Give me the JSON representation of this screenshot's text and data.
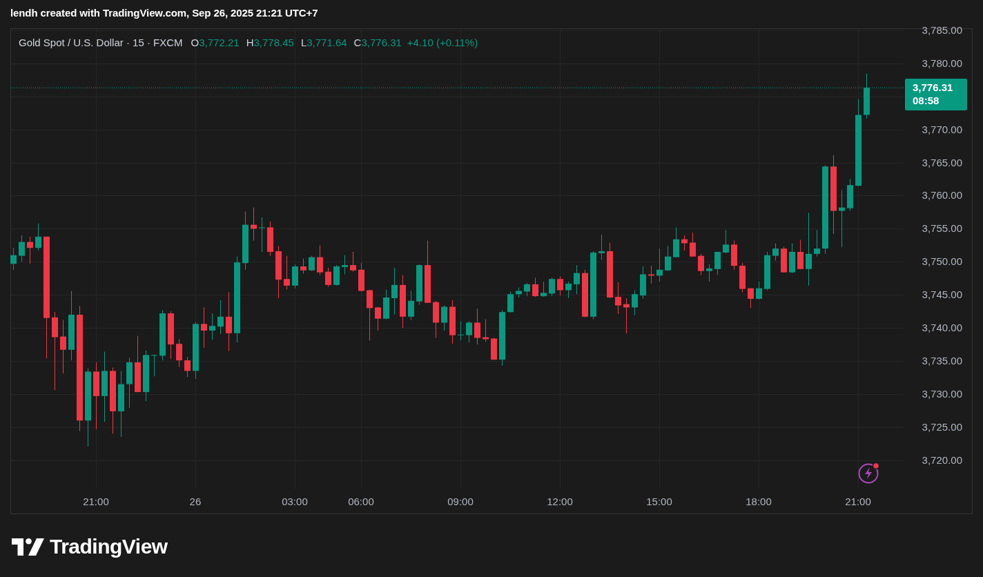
{
  "header": {
    "title": "lendh created with TradingView.com, Sep 26, 2025 21:21 UTC+7"
  },
  "chart": {
    "legend": {
      "symbol": "Gold Spot / U.S. Dollar · 15 · FXCM",
      "fields": [
        {
          "label": "O",
          "value": "3,772.21"
        },
        {
          "label": "H",
          "value": "3,778.45"
        },
        {
          "label": "L",
          "value": "3,771.64"
        },
        {
          "label": "C",
          "value": "3,776.31"
        }
      ],
      "change": "+4.10 (+0.11%)"
    },
    "price_label": {
      "price": "3,776.31",
      "countdown": "08:58"
    },
    "candle_colors": [
      {
        "kind": "rising",
        "color": "#089981"
      },
      {
        "kind": "falling",
        "color": "#f23645"
      }
    ],
    "chart_data": {
      "type": "candlestick",
      "ylim": [
        3715.7,
        3785.3
      ],
      "grid": true,
      "ref_lines": [
        {
          "axis": "y",
          "value": 3776.31,
          "color": "#089981"
        }
      ],
      "categories": [
        null,
        null,
        null,
        null,
        null,
        null,
        null,
        null,
        null,
        null,
        "21:00",
        null,
        null,
        null,
        null,
        null,
        null,
        null,
        null,
        null,
        null,
        null,
        "26",
        null,
        null,
        null,
        null,
        null,
        null,
        null,
        null,
        null,
        null,
        null,
        "03:00",
        null,
        null,
        null,
        null,
        null,
        null,
        null,
        "06:00",
        null,
        null,
        null,
        null,
        null,
        null,
        null,
        null,
        null,
        null,
        null,
        "09:00",
        null,
        null,
        null,
        null,
        null,
        null,
        null,
        null,
        null,
        null,
        null,
        "12:00",
        null,
        null,
        null,
        null,
        null,
        null,
        null,
        null,
        null,
        null,
        null,
        "15:00",
        null,
        null,
        null,
        null,
        null,
        null,
        null,
        null,
        null,
        null,
        null,
        "18:00",
        null,
        null,
        null,
        null,
        null,
        null,
        null,
        null,
        null,
        null,
        null,
        "21:00",
        null
      ],
      "yticks": [
        {
          "value": 3720,
          "label": "3,720.00"
        },
        {
          "value": 3725,
          "label": "3,725.00"
        },
        {
          "value": 3730,
          "label": "3,730.00"
        },
        {
          "value": 3735,
          "label": "3,735.00"
        },
        {
          "value": 3740,
          "label": "3,740.00"
        },
        {
          "value": 3745,
          "label": "3,745.00"
        },
        {
          "value": 3750,
          "label": "3,750.00"
        },
        {
          "value": 3755,
          "label": "3,755.00"
        },
        {
          "value": 3760,
          "label": "3,760.00"
        },
        {
          "value": 3765,
          "label": "3,765.00"
        },
        {
          "value": 3770,
          "label": "3,770.00"
        },
        {
          "value": 3780,
          "label": "3,780.00"
        },
        {
          "value": 3785,
          "label": "3,785.00"
        }
      ],
      "ohlc": [
        [
          3749.7,
          3752.1,
          3748.8,
          3751.0
        ],
        [
          3750.9,
          3754.0,
          3750.0,
          3753.0
        ],
        [
          3753.0,
          3753.8,
          3749.7,
          3752.1
        ],
        [
          3752.1,
          3755.8,
          3751.7,
          3753.8
        ],
        [
          3753.8,
          3753.8,
          3735.4,
          3741.5
        ],
        [
          3741.6,
          3742.4,
          3730.6,
          3738.6
        ],
        [
          3738.7,
          3741.2,
          3733.1,
          3736.7
        ],
        [
          3736.7,
          3745.6,
          3735.1,
          3742.0
        ],
        [
          3742.0,
          3743.3,
          3724.4,
          3726.0
        ],
        [
          3726.0,
          3733.9,
          3722.1,
          3733.4
        ],
        [
          3733.4,
          3734.8,
          3724.7,
          3729.7
        ],
        [
          3729.7,
          3736.4,
          3725.8,
          3733.5
        ],
        [
          3733.5,
          3734.0,
          3724.0,
          3727.4
        ],
        [
          3727.4,
          3733.5,
          3723.5,
          3731.5
        ],
        [
          3731.5,
          3735.5,
          3727.9,
          3734.8
        ],
        [
          3734.8,
          3738.8,
          3730.3,
          3730.3
        ],
        [
          3730.3,
          3736.6,
          3728.9,
          3735.9
        ],
        [
          3735.8,
          3736.0,
          3732.7,
          3735.9
        ],
        [
          3735.8,
          3742.7,
          3735.1,
          3742.2
        ],
        [
          3742.2,
          3742.5,
          3735.3,
          3737.5
        ],
        [
          3737.6,
          3738.3,
          3734.1,
          3735.1
        ],
        [
          3735.1,
          3735.6,
          3732.6,
          3733.5
        ],
        [
          3733.5,
          3740.9,
          3732.3,
          3740.6
        ],
        [
          3740.6,
          3743.1,
          3737.0,
          3739.6
        ],
        [
          3739.6,
          3742.2,
          3738.2,
          3740.3
        ],
        [
          3740.2,
          3744.2,
          3739.1,
          3741.7
        ],
        [
          3741.7,
          3745.4,
          3736.5,
          3739.2
        ],
        [
          3739.2,
          3750.8,
          3737.8,
          3749.9
        ],
        [
          3749.8,
          3757.6,
          3748.8,
          3755.6
        ],
        [
          3755.6,
          3758.2,
          3753.2,
          3755.0
        ],
        [
          3755.1,
          3756.7,
          3751.5,
          3755.2
        ],
        [
          3755.2,
          3756.1,
          3750.9,
          3751.5
        ],
        [
          3751.6,
          3752.4,
          3744.5,
          3747.3
        ],
        [
          3747.4,
          3750.9,
          3745.8,
          3746.4
        ],
        [
          3746.4,
          3749.6,
          3746.0,
          3749.3
        ],
        [
          3749.3,
          3750.5,
          3748.2,
          3748.7
        ],
        [
          3748.7,
          3750.9,
          3748.6,
          3750.7
        ],
        [
          3750.7,
          3752.5,
          3748.0,
          3748.4
        ],
        [
          3748.5,
          3749.1,
          3746.2,
          3746.5
        ],
        [
          3746.5,
          3749.5,
          3746.4,
          3749.3
        ],
        [
          3749.2,
          3751.0,
          3748.1,
          3749.5
        ],
        [
          3749.5,
          3751.5,
          3748.5,
          3748.7
        ],
        [
          3748.8,
          3749.8,
          3745.5,
          3745.6
        ],
        [
          3745.7,
          3745.8,
          3738.1,
          3743.0
        ],
        [
          3743.1,
          3743.2,
          3739.6,
          3741.4
        ],
        [
          3741.4,
          3745.8,
          3741.3,
          3744.6
        ],
        [
          3744.5,
          3749.1,
          3742.0,
          3746.5
        ],
        [
          3746.5,
          3748.0,
          3740.0,
          3741.7
        ],
        [
          3741.7,
          3745.6,
          3741.2,
          3744.1
        ],
        [
          3744.0,
          3749.6,
          3743.5,
          3749.5
        ],
        [
          3749.5,
          3753.2,
          3743.8,
          3743.8
        ],
        [
          3743.9,
          3744.1,
          3738.5,
          3740.8
        ],
        [
          3740.8,
          3743.4,
          3739.6,
          3743.2
        ],
        [
          3743.2,
          3744.2,
          3737.6,
          3738.9
        ],
        [
          3738.9,
          3741.0,
          3738.1,
          3739.0
        ],
        [
          3738.9,
          3741.0,
          3737.8,
          3740.8
        ],
        [
          3740.8,
          3742.9,
          3737.5,
          3738.5
        ],
        [
          3738.6,
          3741.3,
          3737.9,
          3738.3
        ],
        [
          3738.4,
          3738.5,
          3735.2,
          3735.2
        ],
        [
          3735.2,
          3742.7,
          3734.3,
          3742.4
        ],
        [
          3742.4,
          3745.5,
          3742.3,
          3745.1
        ],
        [
          3745.1,
          3746.1,
          3744.6,
          3745.6
        ],
        [
          3745.5,
          3746.8,
          3744.8,
          3746.6
        ],
        [
          3746.6,
          3747.6,
          3744.7,
          3744.8
        ],
        [
          3744.8,
          3747.0,
          3744.7,
          3745.3
        ],
        [
          3745.2,
          3747.6,
          3744.8,
          3747.4
        ],
        [
          3747.4,
          3747.8,
          3744.9,
          3745.7
        ],
        [
          3745.7,
          3747.0,
          3744.5,
          3746.7
        ],
        [
          3746.6,
          3749.5,
          3745.1,
          3748.3
        ],
        [
          3748.3,
          3748.8,
          3741.6,
          3741.7
        ],
        [
          3741.7,
          3751.6,
          3741.3,
          3751.4
        ],
        [
          3751.3,
          3754.1,
          3750.3,
          3751.6
        ],
        [
          3751.6,
          3752.9,
          3744.5,
          3744.6
        ],
        [
          3744.7,
          3746.9,
          3742.1,
          3743.4
        ],
        [
          3743.6,
          3744.5,
          3739.2,
          3743.1
        ],
        [
          3743.1,
          3745.7,
          3741.9,
          3745.1
        ],
        [
          3744.9,
          3749.3,
          3744.4,
          3748.1
        ],
        [
          3748.1,
          3749.4,
          3746.7,
          3747.9
        ],
        [
          3747.9,
          3752.0,
          3747.0,
          3748.8
        ],
        [
          3748.7,
          3752.4,
          3748.6,
          3750.8
        ],
        [
          3750.7,
          3755.2,
          3750.7,
          3753.4
        ],
        [
          3753.4,
          3754.0,
          3751.7,
          3752.8
        ],
        [
          3752.9,
          3754.4,
          3750.8,
          3750.8
        ],
        [
          3750.9,
          3751.2,
          3748.0,
          3748.6
        ],
        [
          3748.6,
          3749.6,
          3747.0,
          3749.0
        ],
        [
          3748.9,
          3751.5,
          3748.0,
          3751.5
        ],
        [
          3751.4,
          3754.8,
          3751.3,
          3752.6
        ],
        [
          3752.6,
          3753.2,
          3748.8,
          3749.4
        ],
        [
          3749.4,
          3749.8,
          3745.4,
          3745.9
        ],
        [
          3746.0,
          3746.0,
          3743.0,
          3744.4
        ],
        [
          3744.4,
          3747.0,
          3744.3,
          3746.0
        ],
        [
          3745.9,
          3751.5,
          3745.7,
          3751.0
        ],
        [
          3750.9,
          3752.8,
          3750.2,
          3752.0
        ],
        [
          3752.0,
          3752.3,
          3748.4,
          3748.4
        ],
        [
          3748.4,
          3752.8,
          3748.3,
          3751.5
        ],
        [
          3751.5,
          3753.3,
          3748.9,
          3748.9
        ],
        [
          3748.9,
          3757.4,
          3746.4,
          3751.2
        ],
        [
          3751.2,
          3754.8,
          3750.8,
          3752.0
        ],
        [
          3752.0,
          3764.6,
          3751.2,
          3764.4
        ],
        [
          3764.4,
          3766.1,
          3754.2,
          3757.7
        ],
        [
          3757.7,
          3760.8,
          3752.2,
          3758.2
        ],
        [
          3758.1,
          3762.5,
          3757.7,
          3761.6
        ],
        [
          3761.5,
          3774.6,
          3761.4,
          3772.2
        ],
        [
          3772.21,
          3778.45,
          3771.64,
          3776.31
        ]
      ]
    }
  },
  "footer": {
    "logo_text": "TradingView"
  }
}
